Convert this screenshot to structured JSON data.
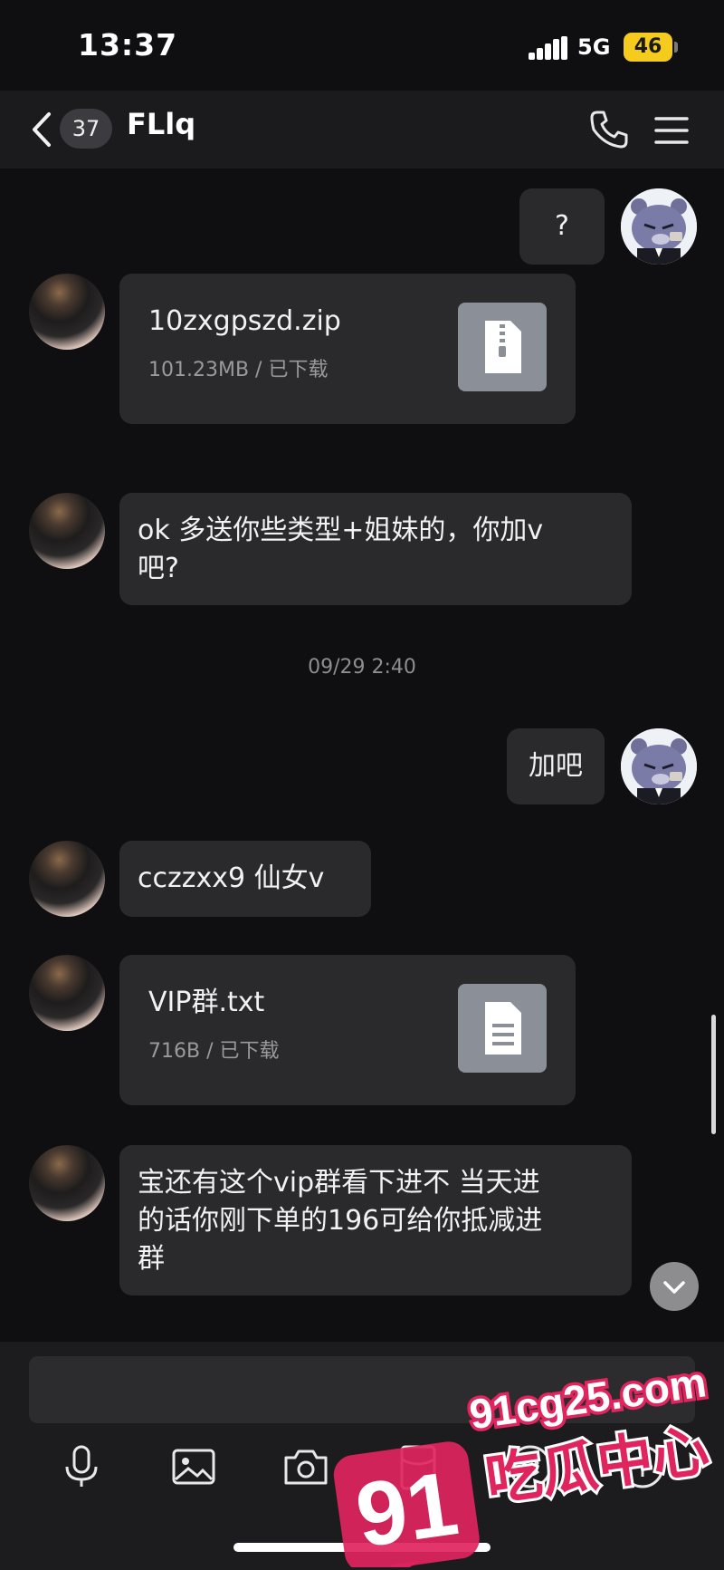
{
  "status_bar": {
    "time": "13:37",
    "network": "5G",
    "battery": "46",
    "battery_color": "#f5cb1e"
  },
  "header": {
    "unread_count": "37",
    "title": "FLlq",
    "back_icon": "chevron-left-icon",
    "call_icon": "phone-icon",
    "menu_icon": "hamburger-menu-icon"
  },
  "messages": [
    {
      "from": "me",
      "type": "text",
      "text": "?"
    },
    {
      "from": "them",
      "type": "file",
      "name": "10zxgpszd.zip",
      "meta": "101.23MB / 已下载",
      "icon": "zip-file-icon"
    },
    {
      "from": "them",
      "type": "text",
      "lines": [
        "ok 多送你些类型+姐妹的，你加v",
        "吧?"
      ]
    },
    {
      "type": "timestamp",
      "text": "09/29 2:40"
    },
    {
      "from": "me",
      "type": "text",
      "text": "加吧"
    },
    {
      "from": "them",
      "type": "text",
      "text": "cczzxx9  仙女v"
    },
    {
      "from": "them",
      "type": "file",
      "name": "VIP群.txt",
      "meta": "716B / 已下载",
      "icon": "text-file-icon"
    },
    {
      "from": "them",
      "type": "text",
      "lines": [
        "宝还有这个vip群看下进不 当天进",
        "的话你刚下单的196可给你抵减进",
        "群"
      ]
    }
  ],
  "input_bar": {
    "tools": [
      "microphone-icon",
      "image-icon",
      "camera-icon",
      "red-packet-icon",
      "emoji-icon",
      "plus-icon"
    ]
  },
  "watermark": {
    "number": "91",
    "site": "91cg25.com",
    "name": "吃瓜中心",
    "color": "#e0245e"
  }
}
